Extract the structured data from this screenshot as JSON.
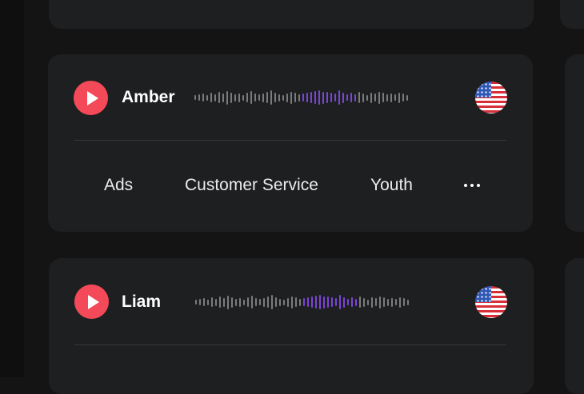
{
  "voices": [
    {
      "name": "Amber",
      "flag_icon": "us-flag-icon",
      "tags": [
        "Ads",
        "Customer Service",
        "Youth"
      ],
      "more_icon": "more-horizontal-icon"
    },
    {
      "name": "Liam",
      "flag_icon": "us-flag-icon"
    }
  ],
  "colors": {
    "background": "#141414",
    "card": "#1e1f20",
    "play_button": "#f44958",
    "waveform": "#7b7b7b",
    "waveform_highlight": "#7a45d9",
    "divider": "#363738"
  }
}
